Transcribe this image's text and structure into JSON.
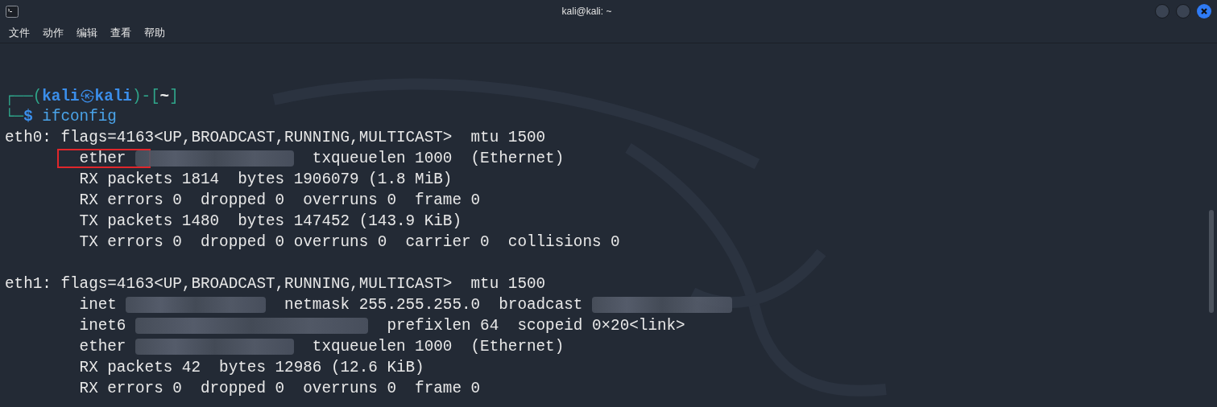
{
  "window": {
    "title": "kali@kali: ~"
  },
  "menu": [
    {
      "label": "文件"
    },
    {
      "label": "动作"
    },
    {
      "label": "编辑"
    },
    {
      "label": "查看"
    },
    {
      "label": "帮助"
    }
  ],
  "prompt": [
    {
      "kind": "frame",
      "text": "┌──("
    },
    {
      "kind": "user",
      "text": "kali"
    },
    {
      "kind": "symbol",
      "text": "㉿"
    },
    {
      "kind": "user",
      "text": "kali"
    },
    {
      "kind": "frame",
      "text": ")-["
    },
    {
      "kind": "dir",
      "text": "~"
    },
    {
      "kind": "frame",
      "text": "]"
    }
  ],
  "command_line": [
    {
      "kind": "frame",
      "text": "└─"
    },
    {
      "kind": "sign",
      "text": "$"
    },
    {
      "kind": "command",
      "text": " ifconfig"
    }
  ],
  "lines": [
    {
      "kind": "output",
      "segments": [
        {
          "kind": "text",
          "text": "eth0: flags=4163<UP,BROADCAST,RUNNING,MULTICAST>  mtu 1500",
          "highlighted": false
        }
      ]
    },
    {
      "kind": "output",
      "segments": [
        {
          "kind": "text",
          "text": "        ether ",
          "highlighted": true
        },
        {
          "kind": "mac"
        },
        {
          "kind": "text",
          "text": "  txqueuelen 1000  (Ethernet)",
          "highlighted": false
        }
      ]
    },
    {
      "kind": "output",
      "segments": [
        {
          "kind": "text",
          "text": "        RX packets 1814  bytes 1906079 (1.8 MiB)",
          "highlighted": false
        }
      ]
    },
    {
      "kind": "output",
      "segments": [
        {
          "kind": "text",
          "text": "        RX errors 0  dropped 0  overruns 0  frame 0",
          "highlighted": false
        }
      ]
    },
    {
      "kind": "output",
      "segments": [
        {
          "kind": "text",
          "text": "        TX packets 1480  bytes 147452 (143.9 KiB)",
          "highlighted": false
        }
      ]
    },
    {
      "kind": "output",
      "segments": [
        {
          "kind": "text",
          "text": "        TX errors 0  dropped 0 overruns 0  carrier 0  collisions 0",
          "highlighted": false
        }
      ]
    },
    {
      "kind": "blank"
    },
    {
      "kind": "output",
      "segments": [
        {
          "kind": "text",
          "text": "eth1: flags=4163<UP,BROADCAST,RUNNING,MULTICAST>  mtu 1500",
          "highlighted": false
        }
      ]
    },
    {
      "kind": "output",
      "segments": [
        {
          "kind": "text",
          "text": "        inet ",
          "highlighted": false
        },
        {
          "kind": "ipv4"
        },
        {
          "kind": "text",
          "text": "  netmask 255.255.255.0  broadcast ",
          "highlighted": false
        },
        {
          "kind": "ipv4"
        }
      ]
    },
    {
      "kind": "output",
      "segments": [
        {
          "kind": "text",
          "text": "        inet6 ",
          "highlighted": false
        },
        {
          "kind": "ipv6"
        },
        {
          "kind": "text",
          "text": "  prefixlen 64  scopeid 0×20<link>",
          "highlighted": false
        }
      ]
    },
    {
      "kind": "output",
      "segments": [
        {
          "kind": "text",
          "text": "        ether ",
          "highlighted": false
        },
        {
          "kind": "mac"
        },
        {
          "kind": "text",
          "text": "  txqueuelen 1000  (Ethernet)",
          "highlighted": false
        }
      ]
    },
    {
      "kind": "output",
      "segments": [
        {
          "kind": "text",
          "text": "        RX packets 42  bytes 12986 (12.6 KiB)",
          "highlighted": false
        }
      ]
    },
    {
      "kind": "output",
      "segments": [
        {
          "kind": "text",
          "text": "        RX errors 0  dropped 0  overruns 0  frame 0",
          "highlighted": false
        }
      ]
    }
  ]
}
